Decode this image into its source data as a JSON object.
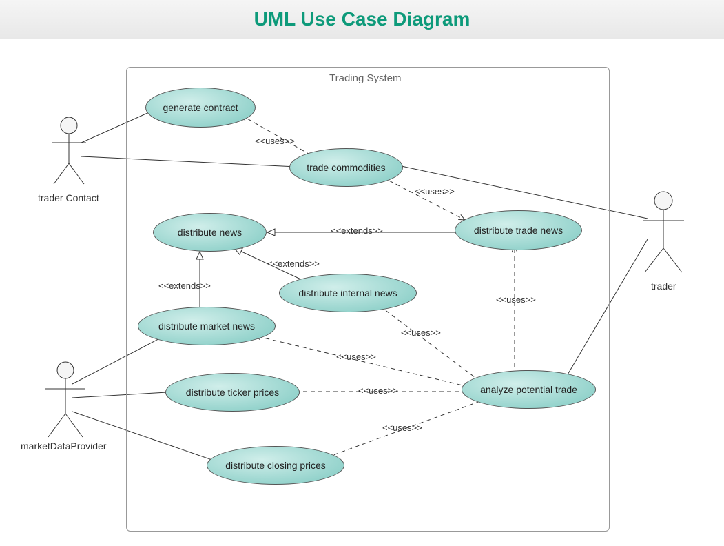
{
  "title": "UML Use Case Diagram",
  "system": {
    "label": "Trading System"
  },
  "actors": {
    "traderContact": "trader Contact",
    "trader": "trader",
    "marketDataProvider": "marketDataProvider"
  },
  "useCases": {
    "generateContract": "generate contract",
    "tradeCommodities": "trade commodities",
    "distributeNews": "distribute news",
    "distributeTradeNews": "distribute trade news",
    "distributeInternalNews": "distribute internal news",
    "distributeMarketNews": "distribute market news",
    "distributeTickerPrices": "distribute ticker prices",
    "analyzePotentialTrade": "analyze potential trade",
    "distributeClosingPrices": "distribute closing prices"
  },
  "stereotypes": {
    "uses1": "<<uses>>",
    "uses2": "<<uses>>",
    "uses3": "<<uses>>",
    "uses4": "<<uses>>",
    "uses5": "<<uses>>",
    "uses6": "<<uses>>",
    "uses7": "<<uses>>",
    "extends1": "<<extends>>",
    "extends2": "<<extends>>",
    "extends3": "<<extends>>"
  }
}
